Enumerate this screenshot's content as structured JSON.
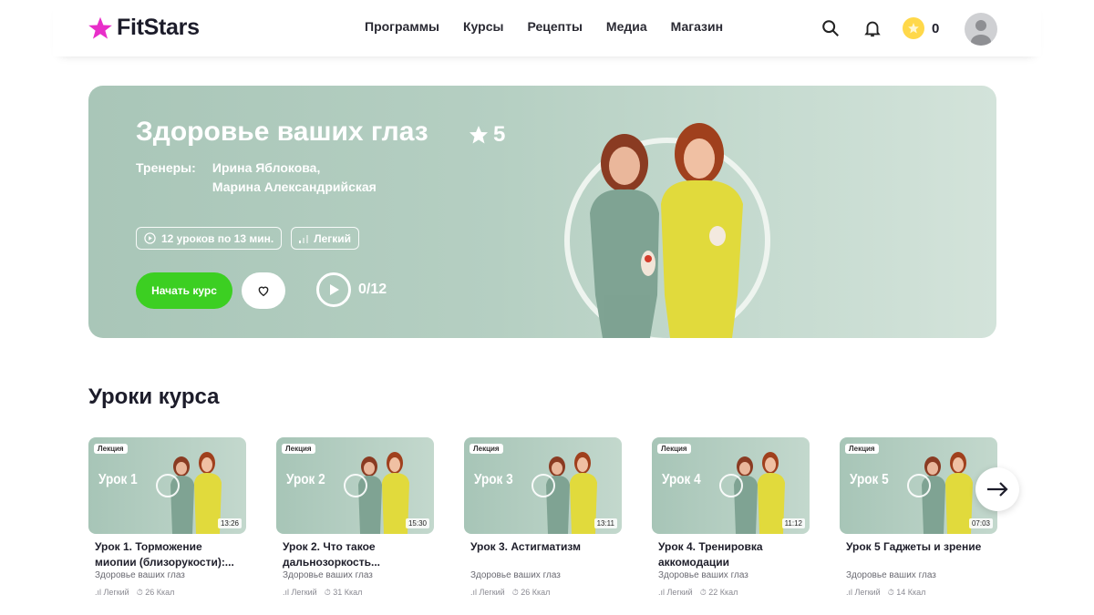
{
  "header": {
    "logo_text": "FitStars",
    "brand_color": "#e82ec9",
    "nav": [
      "Программы",
      "Курсы",
      "Рецепты",
      "Медиа",
      "Магазин"
    ],
    "coin_count": "0"
  },
  "hero": {
    "title": "Здоровье ваших глаз",
    "rating": "5",
    "trainers_label": "Тренеры:",
    "trainer_1": "Ирина Яблокова,",
    "trainer_2": "Марина Александрийская",
    "tag_lessons": "12 уроков по 13 мин.",
    "tag_level": "Легкий",
    "start_label": "Начать курс",
    "progress": "0/12",
    "accent": "#3ccf22"
  },
  "section_title": "Уроки курса",
  "lessons": [
    {
      "badge": "Лекция",
      "thumb": "Урок 1",
      "duration": "13:26",
      "title": "Урок 1. Торможение миопии (близорукости):...",
      "course": "Здоровье ваших глаз",
      "level": "Легкий",
      "kcal": "26 Ккал"
    },
    {
      "badge": "Лекция",
      "thumb": "Урок 2",
      "duration": "15:30",
      "title": "Урок 2. Что такое дальнозоркость...",
      "course": "Здоровье ваших глаз",
      "level": "Легкий",
      "kcal": "31 Ккал"
    },
    {
      "badge": "Лекция",
      "thumb": "Урок 3",
      "duration": "13:11",
      "title": "Урок 3. Астигматизм",
      "course": "Здоровье ваших глаз",
      "level": "Легкий",
      "kcal": "26 Ккал"
    },
    {
      "badge": "Лекция",
      "thumb": "Урок 4",
      "duration": "11:12",
      "title": "Урок 4. Тренировка аккомодации",
      "course": "Здоровье ваших глаз",
      "level": "Легкий",
      "kcal": "22 Ккал"
    },
    {
      "badge": "Лекция",
      "thumb": "Урок 5",
      "duration": "07:03",
      "title": "Урок 5 Гаджеты и зрение",
      "course": "Здоровье ваших глаз",
      "level": "Легкий",
      "kcal": "14 Ккал"
    }
  ]
}
